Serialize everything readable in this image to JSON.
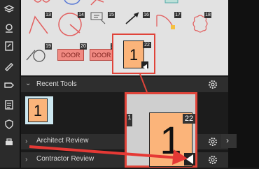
{
  "tool_numbers": [
    "13",
    "14",
    "15",
    "16",
    "17",
    "18",
    "19",
    "20",
    "21",
    "22"
  ],
  "tools": {
    "door_label": "DOOR",
    "tile_value": "1"
  },
  "sections": {
    "recent": "Recent Tools",
    "architect": "Architect Review",
    "contractor": "Contractor Review"
  },
  "recent_tile_value": "1",
  "zoom_callout": {
    "tile_value": "1",
    "badge": "22",
    "side_badge": "1"
  },
  "colors": {
    "highlight": "#e0443a",
    "arrow": "#e53935",
    "tile": "#fbb47a"
  },
  "icons": [
    "layers-icon",
    "location-pin-icon",
    "edit-doc-icon",
    "pen-icon",
    "tag-icon",
    "checklist-icon",
    "shield-icon",
    "print-icon",
    "gear-icon",
    "chevron-right-icon"
  ]
}
